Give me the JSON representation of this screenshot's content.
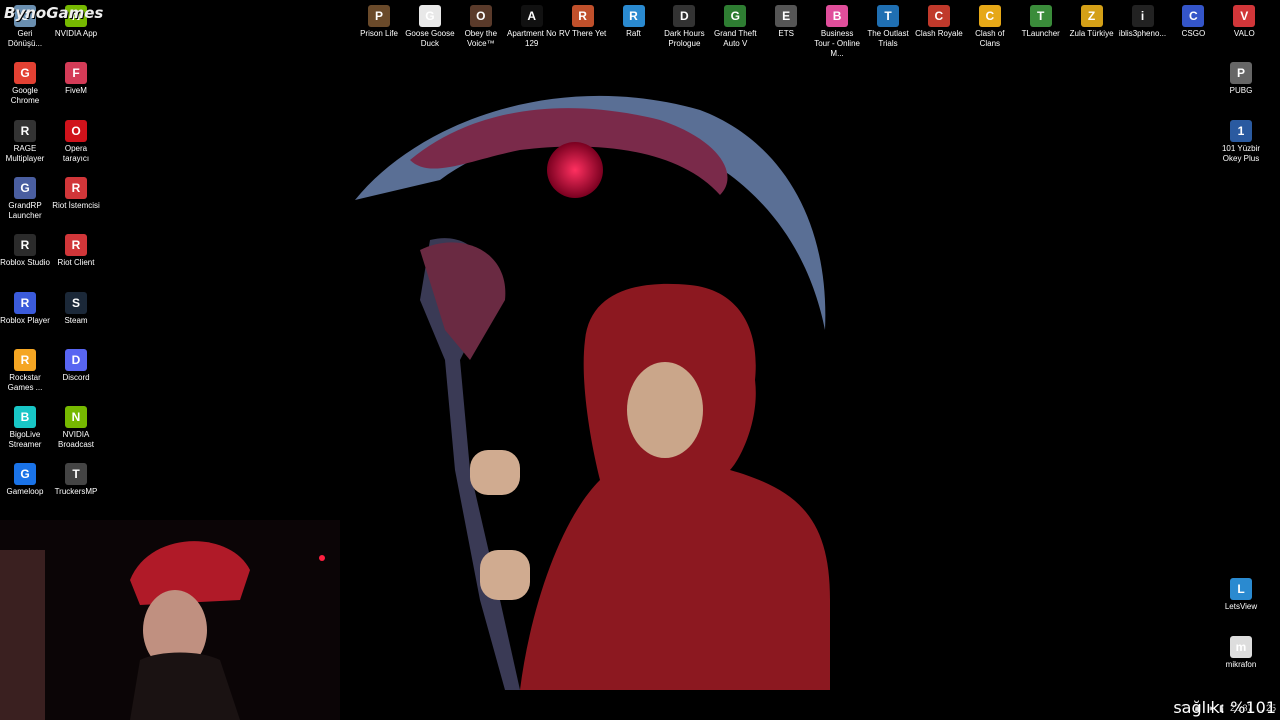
{
  "overlay": {
    "brand": "BynoGames",
    "health": "sağlık: %101"
  },
  "desktop_left": [
    {
      "label": "Geri Dönüşü...",
      "icon": "recycle-bin-icon",
      "color": "#6a8fb0"
    },
    {
      "label": "NVIDIA App",
      "icon": "nvidia-icon",
      "color": "#76b900"
    },
    {
      "label": "Google Chrome",
      "icon": "chrome-icon",
      "color": "#e34133"
    },
    {
      "label": "FiveM",
      "icon": "fivem-icon",
      "color": "#d43b57"
    },
    {
      "label": "RAGE Multiplayer",
      "icon": "rage-icon",
      "color": "#333333"
    },
    {
      "label": "Opera tarayıcı",
      "icon": "opera-icon",
      "color": "#d0121b"
    },
    {
      "label": "GrandRP Launcher",
      "icon": "grandrp-icon",
      "color": "#4a5ea0"
    },
    {
      "label": "Riot İstemcisi",
      "icon": "riot-icon",
      "color": "#d13639"
    },
    {
      "label": "Roblox Studio",
      "icon": "roblox-studio-icon",
      "color": "#2b2b2b"
    },
    {
      "label": "Riot Client",
      "icon": "riot-client-icon",
      "color": "#d13639"
    },
    {
      "label": "Roblox Player",
      "icon": "roblox-icon",
      "color": "#3b5bdb"
    },
    {
      "label": "Steam",
      "icon": "steam-icon",
      "color": "#1b2838"
    },
    {
      "label": "Rockstar Games ...",
      "icon": "rockstar-icon",
      "color": "#f5a623"
    },
    {
      "label": "Discord",
      "icon": "discord-icon",
      "color": "#5865f2"
    },
    {
      "label": "BigoLive Streamer",
      "icon": "bigolive-icon",
      "color": "#18c6c6"
    },
    {
      "label": "NVIDIA Broadcast",
      "icon": "nvidia-broadcast-icon",
      "color": "#76b900"
    },
    {
      "label": "Gameloop",
      "icon": "gameloop-icon",
      "color": "#1a73e8"
    },
    {
      "label": "TruckersMP",
      "icon": "truckersmp-icon",
      "color": "#444444"
    }
  ],
  "desktop_top": [
    {
      "label": "Prison Life",
      "icon": "prison-life-icon",
      "color": "#6a4a2a"
    },
    {
      "label": "Goose Goose Duck",
      "icon": "goose-duck-icon",
      "color": "#e8e8e8"
    },
    {
      "label": "Obey the Voice™",
      "icon": "obey-voice-icon",
      "color": "#5a3a2a"
    },
    {
      "label": "Apartment No 129",
      "icon": "apartment-icon",
      "color": "#111111"
    },
    {
      "label": "RV There Yet",
      "icon": "rv-icon",
      "color": "#c0502b"
    },
    {
      "label": "Raft",
      "icon": "raft-icon",
      "color": "#2a8ad0"
    },
    {
      "label": "Dark Hours Prologue",
      "icon": "dark-hours-icon",
      "color": "#333333"
    },
    {
      "label": "Grand Theft Auto V",
      "icon": "gta-icon",
      "color": "#2e7d32"
    },
    {
      "label": "ETS",
      "icon": "ets-icon",
      "color": "#555555"
    },
    {
      "label": "Business Tour - Online M...",
      "icon": "business-tour-icon",
      "color": "#e04e9b"
    },
    {
      "label": "The Outlast Trials",
      "icon": "outlast-icon",
      "color": "#1f6fb2"
    },
    {
      "label": "Clash Royale",
      "icon": "clash-royale-icon",
      "color": "#c0392b"
    },
    {
      "label": "Clash of Clans",
      "icon": "clash-of-clans-icon",
      "color": "#e6a817"
    },
    {
      "label": "TLauncher",
      "icon": "tlauncher-icon",
      "color": "#3a8c3a"
    },
    {
      "label": "Zula Türkiye",
      "icon": "zula-icon",
      "color": "#d4a017"
    },
    {
      "label": "iblis3pheno...",
      "icon": "iblis-icon",
      "color": "#222222"
    },
    {
      "label": "CSGO",
      "icon": "csgo-icon",
      "color": "#3455c9"
    },
    {
      "label": "VALO",
      "icon": "valorant-icon",
      "color": "#d13639"
    }
  ],
  "desktop_right": [
    {
      "label": "PUBG",
      "icon": "pubg-icon",
      "color": "#666666"
    },
    {
      "label": "101 Yüzbir Okey Plus",
      "icon": "okey-icon",
      "color": "#2a5aa0"
    },
    {
      "label": "LetsView",
      "icon": "letsview-icon",
      "color": "#2a8ad0"
    },
    {
      "label": "mikrafon",
      "icon": "microphone-file-icon",
      "color": "#dddddd"
    }
  ],
  "tray": {
    "time": "22:37",
    "date": "...25"
  }
}
